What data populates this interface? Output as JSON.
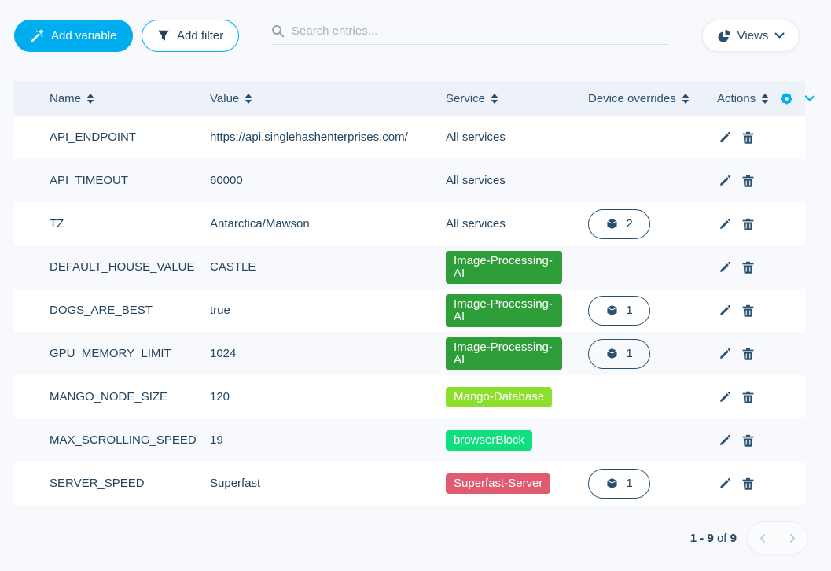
{
  "toolbar": {
    "add_variable": "Add variable",
    "add_filter": "Add filter",
    "search_placeholder": "Search entries...",
    "views": "Views"
  },
  "table": {
    "columns": [
      {
        "label": "Name"
      },
      {
        "label": "Value"
      },
      {
        "label": "Service"
      },
      {
        "label": "Device overrides"
      },
      {
        "label": "Actions"
      }
    ],
    "rows": [
      {
        "name": "API_ENDPOINT",
        "value": "https://api.singlehashenterprises.com/",
        "service": {
          "type": "text",
          "label": "All services"
        },
        "device_overrides": null
      },
      {
        "name": "API_TIMEOUT",
        "value": "60000",
        "service": {
          "type": "text",
          "label": "All services"
        },
        "device_overrides": null
      },
      {
        "name": "TZ",
        "value": "Antarctica/Mawson",
        "service": {
          "type": "text",
          "label": "All services"
        },
        "device_overrides": 2
      },
      {
        "name": "DEFAULT_HOUSE_VALUE",
        "value": "CASTLE",
        "service": {
          "type": "badge",
          "label": "Image-Processing-AI",
          "color": "#2e9e38"
        },
        "device_overrides": null
      },
      {
        "name": "DOGS_ARE_BEST",
        "value": "true",
        "service": {
          "type": "badge",
          "label": "Image-Processing-AI",
          "color": "#2e9e38"
        },
        "device_overrides": 1
      },
      {
        "name": "GPU_MEMORY_LIMIT",
        "value": "1024",
        "service": {
          "type": "badge",
          "label": "Image-Processing-AI",
          "color": "#2e9e38"
        },
        "device_overrides": 1
      },
      {
        "name": "MANGO_NODE_SIZE",
        "value": "120",
        "service": {
          "type": "badge",
          "label": "Mango-Database",
          "color": "#8cdf2a"
        },
        "device_overrides": null
      },
      {
        "name": "MAX_SCROLLING_SPEED",
        "value": "19",
        "service": {
          "type": "badge",
          "label": "browserBlock",
          "color": "#10df7d"
        },
        "device_overrides": null
      },
      {
        "name": "SERVER_SPEED",
        "value": "Superfast",
        "service": {
          "type": "badge",
          "label": "Superfast-Server",
          "color": "#e05b6d"
        },
        "device_overrides": 1
      }
    ]
  },
  "pagination": {
    "range": "1 - 9",
    "of_label": "of",
    "total": "9"
  },
  "colors": {
    "accent": "#00aeef",
    "text": "#23445e",
    "icon_blue": "#2a506f",
    "header_bg": "#edf1f8"
  }
}
